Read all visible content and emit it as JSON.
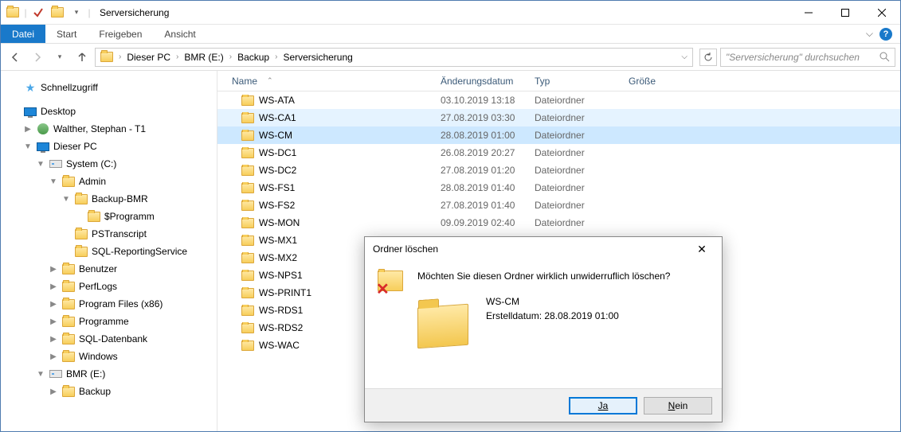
{
  "window": {
    "title": "Serversicherung"
  },
  "ribbon": {
    "file": "Datei",
    "tabs": [
      "Start",
      "Freigeben",
      "Ansicht"
    ]
  },
  "breadcrumbs": [
    "Dieser PC",
    "BMR (E:)",
    "Backup",
    "Serversicherung"
  ],
  "search": {
    "placeholder": "\"Serversicherung\" durchsuchen"
  },
  "tree": [
    {
      "label": "Schnellzugriff",
      "icon": "star",
      "depth": 0,
      "exp": ""
    },
    {
      "label": "Desktop",
      "icon": "monitor",
      "depth": 0,
      "exp": "",
      "spaceBefore": true
    },
    {
      "label": "Walther, Stephan - T1",
      "icon": "user",
      "depth": 1,
      "exp": "▶"
    },
    {
      "label": "Dieser PC",
      "icon": "monitor",
      "depth": 1,
      "exp": "▼"
    },
    {
      "label": "System (C:)",
      "icon": "drive",
      "depth": 2,
      "exp": "▼"
    },
    {
      "label": "Admin",
      "icon": "folder",
      "depth": 3,
      "exp": "▼"
    },
    {
      "label": "Backup-BMR",
      "icon": "folder",
      "depth": 4,
      "exp": "▼"
    },
    {
      "label": "$Programm",
      "icon": "folder",
      "depth": 5,
      "exp": ""
    },
    {
      "label": "PSTranscript",
      "icon": "folder",
      "depth": 4,
      "exp": ""
    },
    {
      "label": "SQL-ReportingService",
      "icon": "folder",
      "depth": 4,
      "exp": ""
    },
    {
      "label": "Benutzer",
      "icon": "folder",
      "depth": 3,
      "exp": "▶"
    },
    {
      "label": "PerfLogs",
      "icon": "folder",
      "depth": 3,
      "exp": "▶"
    },
    {
      "label": "Program Files (x86)",
      "icon": "folder",
      "depth": 3,
      "exp": "▶"
    },
    {
      "label": "Programme",
      "icon": "folder",
      "depth": 3,
      "exp": "▶"
    },
    {
      "label": "SQL-Datenbank",
      "icon": "folder",
      "depth": 3,
      "exp": "▶"
    },
    {
      "label": "Windows",
      "icon": "folder",
      "depth": 3,
      "exp": "▶"
    },
    {
      "label": "BMR (E:)",
      "icon": "drive",
      "depth": 2,
      "exp": "▼"
    },
    {
      "label": "Backup",
      "icon": "folder",
      "depth": 3,
      "exp": "▶"
    }
  ],
  "columns": {
    "name": "Name",
    "date": "Änderungsdatum",
    "type": "Typ",
    "size": "Größe"
  },
  "rows": [
    {
      "name": "WS-ATA",
      "date": "03.10.2019 13:18",
      "type": "Dateiordner",
      "state": ""
    },
    {
      "name": "WS-CA1",
      "date": "27.08.2019 03:30",
      "type": "Dateiordner",
      "state": "hover"
    },
    {
      "name": "WS-CM",
      "date": "28.08.2019 01:00",
      "type": "Dateiordner",
      "state": "selected"
    },
    {
      "name": "WS-DC1",
      "date": "26.08.2019 20:27",
      "type": "Dateiordner",
      "state": ""
    },
    {
      "name": "WS-DC2",
      "date": "27.08.2019 01:20",
      "type": "Dateiordner",
      "state": ""
    },
    {
      "name": "WS-FS1",
      "date": "28.08.2019 01:40",
      "type": "Dateiordner",
      "state": ""
    },
    {
      "name": "WS-FS2",
      "date": "27.08.2019 01:40",
      "type": "Dateiordner",
      "state": ""
    },
    {
      "name": "WS-MON",
      "date": "09.09.2019 02:40",
      "type": "Dateiordner",
      "state": ""
    },
    {
      "name": "WS-MX1",
      "date": "",
      "type": "",
      "state": ""
    },
    {
      "name": "WS-MX2",
      "date": "",
      "type": "",
      "state": ""
    },
    {
      "name": "WS-NPS1",
      "date": "",
      "type": "",
      "state": ""
    },
    {
      "name": "WS-PRINT1",
      "date": "",
      "type": "",
      "state": ""
    },
    {
      "name": "WS-RDS1",
      "date": "",
      "type": "",
      "state": ""
    },
    {
      "name": "WS-RDS2",
      "date": "",
      "type": "",
      "state": ""
    },
    {
      "name": "WS-WAC",
      "date": "",
      "type": "",
      "state": ""
    }
  ],
  "dialog": {
    "title": "Ordner löschen",
    "question": "Möchten Sie diesen Ordner wirklich unwiderruflich löschen?",
    "item_name": "WS-CM",
    "meta_label": "Erstelldatum:",
    "meta_value": "28.08.2019 01:00",
    "yes": "Ja",
    "no": "Nein"
  }
}
